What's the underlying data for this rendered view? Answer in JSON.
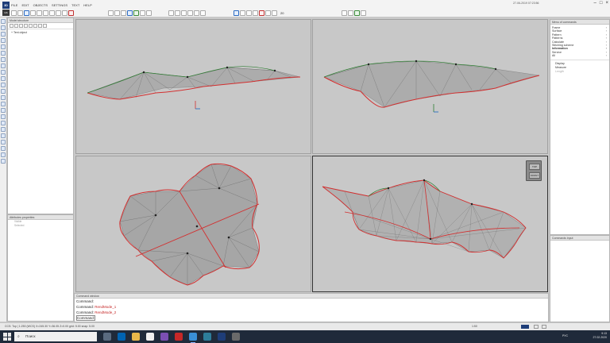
{
  "app": {
    "logo_text": "3D",
    "logo2_text": "GS",
    "menu": [
      "FILE",
      "EDIT",
      "OBJECTS",
      "SETTINGS",
      "TEXT",
      "HELP"
    ],
    "window_info": "27-06-2019   07:23:56",
    "zoom_label": "20"
  },
  "left_panel": {
    "title": "Model structure",
    "tree_item": "Tent object"
  },
  "attr_panel": {
    "title": "Attributes properties",
    "rows": [
      "Visible",
      "Selected"
    ]
  },
  "right_panel": {
    "title": "Menu of commands",
    "items": [
      {
        "label": "Frame",
        "arrow": "›"
      },
      {
        "label": "Surface",
        "arrow": "›"
      },
      {
        "label": "Pattern",
        "arrow": "›"
      },
      {
        "label": "Patterns",
        "arrow": "›"
      },
      {
        "label": "Calculate",
        "arrow": "›"
      },
      {
        "label": "Stitching scheme",
        "arrow": "›"
      },
      {
        "label": "Information",
        "arrow": "›"
      },
      {
        "label": "Service",
        "arrow": "›"
      },
      {
        "label": "All",
        "arrow": "›"
      }
    ],
    "subitems": [
      "Display",
      "Measure",
      "Length"
    ]
  },
  "cmd_log": {
    "title": "Commands input"
  },
  "command_panel": {
    "title": "Command window",
    "lines": [
      {
        "prefix": "Command:",
        "value": ""
      },
      {
        "prefix": "Command:",
        "value": "RendMode_1"
      },
      {
        "prefix": "Command:",
        "value": "RendMode_2"
      }
    ],
    "prompt": "Command:"
  },
  "viewcube": {
    "top": "TOP",
    "front": "FRONT"
  },
  "status": {
    "left": "CCS: Top   |   1:250 (WCS)   X=245.30 Y=36.05 Z=0.00  grid: 5.00  snap: 5.00",
    "right_scale": "1:50"
  },
  "taskbar": {
    "search_placeholder": "Поиск",
    "lang": "РУС",
    "time": "9:13",
    "date": "27.02.2020"
  },
  "colors": {
    "accent": "#1e3d78",
    "membrane": "#7a7a7a",
    "edge_red": "#d32f2f",
    "edge_green": "#2e7d32",
    "taskbar": "#1f2a3a"
  }
}
